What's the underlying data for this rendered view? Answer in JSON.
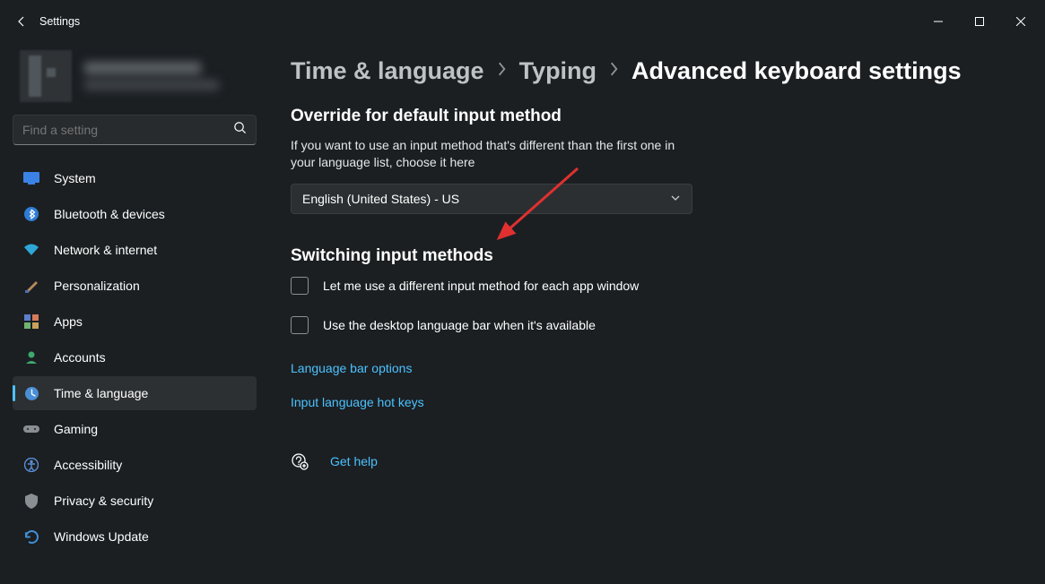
{
  "window": {
    "title": "Settings"
  },
  "search": {
    "placeholder": "Find a setting"
  },
  "sidebar": {
    "items": [
      {
        "label": "System"
      },
      {
        "label": "Bluetooth & devices"
      },
      {
        "label": "Network & internet"
      },
      {
        "label": "Personalization"
      },
      {
        "label": "Apps"
      },
      {
        "label": "Accounts"
      },
      {
        "label": "Time & language"
      },
      {
        "label": "Gaming"
      },
      {
        "label": "Accessibility"
      },
      {
        "label": "Privacy & security"
      },
      {
        "label": "Windows Update"
      }
    ],
    "selected_index": 6
  },
  "breadcrumb": {
    "level1": "Time & language",
    "level2": "Typing",
    "level3": "Advanced keyboard settings"
  },
  "section1": {
    "heading": "Override for default input method",
    "description": "If you want to use an input method that's different than the first one in your language list, choose it here",
    "dropdown_value": "English (United States) - US"
  },
  "section2": {
    "heading": "Switching input methods",
    "checkbox1_label": "Let me use a different input method for each app window",
    "checkbox2_label": "Use the desktop language bar when it's available",
    "link1": "Language bar options",
    "link2": "Input language hot keys"
  },
  "help": {
    "label": "Get help"
  }
}
